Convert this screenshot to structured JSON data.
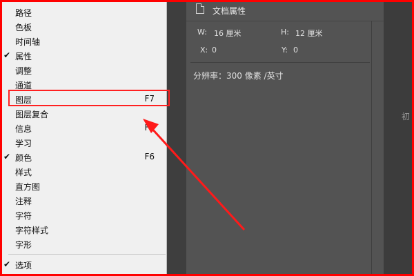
{
  "menu": {
    "items": [
      {
        "label": "路径",
        "checked": false,
        "shortcut": ""
      },
      {
        "label": "色板",
        "checked": false,
        "shortcut": ""
      },
      {
        "label": "时间轴",
        "checked": false,
        "shortcut": ""
      },
      {
        "label": "属性",
        "checked": true,
        "shortcut": ""
      },
      {
        "label": "调整",
        "checked": false,
        "shortcut": ""
      },
      {
        "label": "通道",
        "checked": false,
        "shortcut": ""
      },
      {
        "label": "图层",
        "checked": false,
        "shortcut": "F7"
      },
      {
        "label": "图层复合",
        "checked": false,
        "shortcut": ""
      },
      {
        "label": "信息",
        "checked": false,
        "shortcut": "F8"
      },
      {
        "label": "学习",
        "checked": false,
        "shortcut": ""
      },
      {
        "label": "颜色",
        "checked": true,
        "shortcut": "F6"
      },
      {
        "label": "样式",
        "checked": false,
        "shortcut": ""
      },
      {
        "label": "直方图",
        "checked": false,
        "shortcut": ""
      },
      {
        "label": "注释",
        "checked": false,
        "shortcut": ""
      },
      {
        "label": "字符",
        "checked": false,
        "shortcut": ""
      },
      {
        "label": "字符样式",
        "checked": false,
        "shortcut": ""
      },
      {
        "label": "字形",
        "checked": false,
        "shortcut": ""
      },
      {
        "label": "选项",
        "checked": true,
        "shortcut": ""
      }
    ],
    "check_glyph": "✔"
  },
  "panel": {
    "tab_title": "文档属性",
    "width_label": "W:",
    "width_value": "16 厘米",
    "height_label": "H:",
    "height_value": "12 厘米",
    "x_label": "X:",
    "x_value": "0",
    "y_label": "Y:",
    "y_value": "0",
    "resolution": "分辨率：300 像素 /英寸"
  },
  "right_panel_text": "初",
  "annotation": {
    "highlighted_item": "图层",
    "color": "#ff2020"
  }
}
